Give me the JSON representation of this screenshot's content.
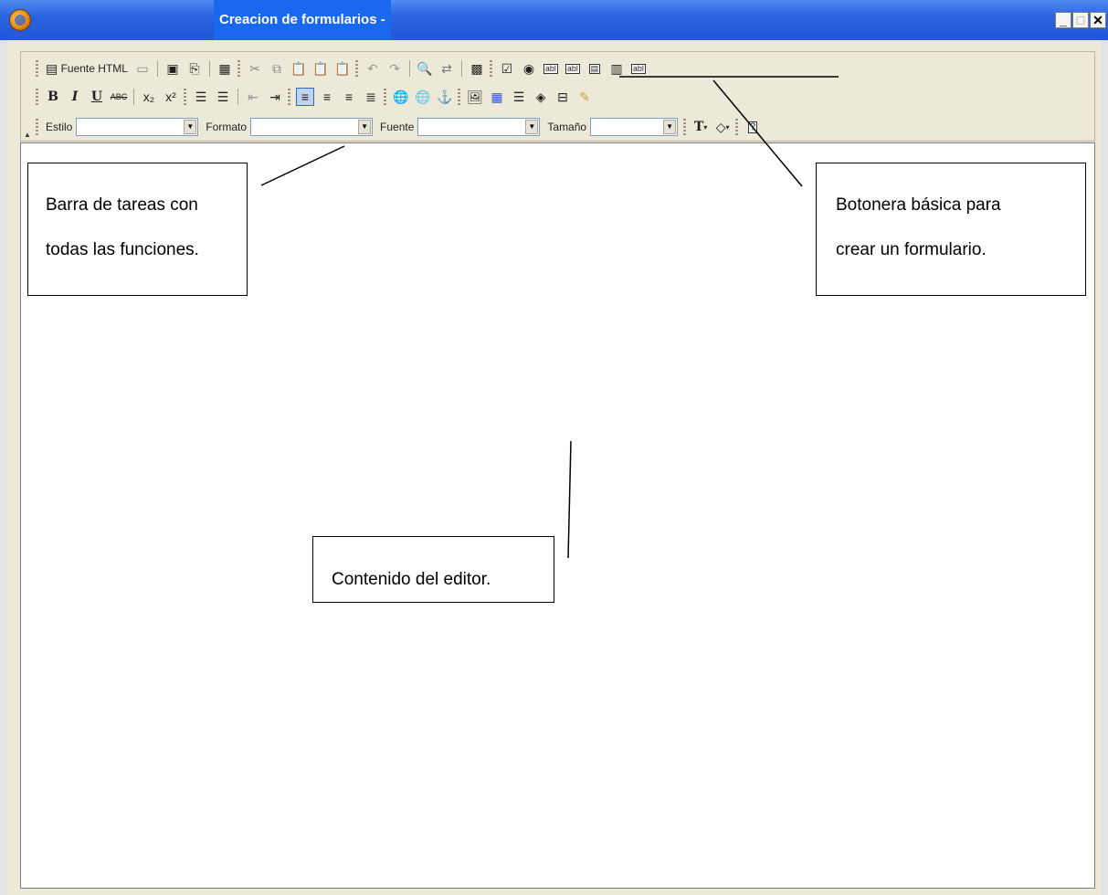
{
  "window": {
    "title": "Creacion de formularios -",
    "minimize": "_",
    "maximize": "□",
    "close": "✕"
  },
  "toolbar": {
    "source_label": "Fuente HTML",
    "style_label": "Estilo",
    "format_label": "Formato",
    "font_label": "Fuente",
    "size_label": "Tamaño",
    "style_value": "",
    "format_value": "",
    "font_value": "",
    "size_value": "",
    "row1_icons": [
      "newpage-icon",
      "save-icon",
      "preview-icon",
      "templates-icon",
      "cut-icon",
      "copy-icon",
      "paste-icon",
      "paste-text-icon",
      "paste-word-icon",
      "undo-icon",
      "redo-icon",
      "find-icon",
      "replace-icon",
      "select-all-icon",
      "checkbox-icon",
      "radio-icon",
      "textfield-icon",
      "textarea-icon",
      "select-field-icon",
      "button-field-icon",
      "hidden-field-icon"
    ],
    "row2_icons": [
      "bold-icon",
      "italic-icon",
      "underline-icon",
      "strike-icon",
      "subscript-icon",
      "superscript-icon",
      "ordered-list-icon",
      "unordered-list-icon",
      "outdent-icon",
      "indent-icon",
      "align-left-icon",
      "align-center-icon",
      "align-right-icon",
      "justify-icon",
      "link-icon",
      "unlink-icon",
      "anchor-icon",
      "image-icon",
      "table-icon",
      "rule-icon",
      "smiley-icon",
      "special-char-icon",
      "uipcolor-icon"
    ],
    "row3_icons": [
      "text-color-icon",
      "bg-color-icon",
      "help-icon"
    ]
  },
  "annotations": {
    "toolbar_note_line1": "Barra de tareas con",
    "toolbar_note_line2": "todas las funciones.",
    "form_note_line1": "Botonera básica para",
    "form_note_line2": "crear un formulario.",
    "editor_note": "Contenido del editor."
  }
}
